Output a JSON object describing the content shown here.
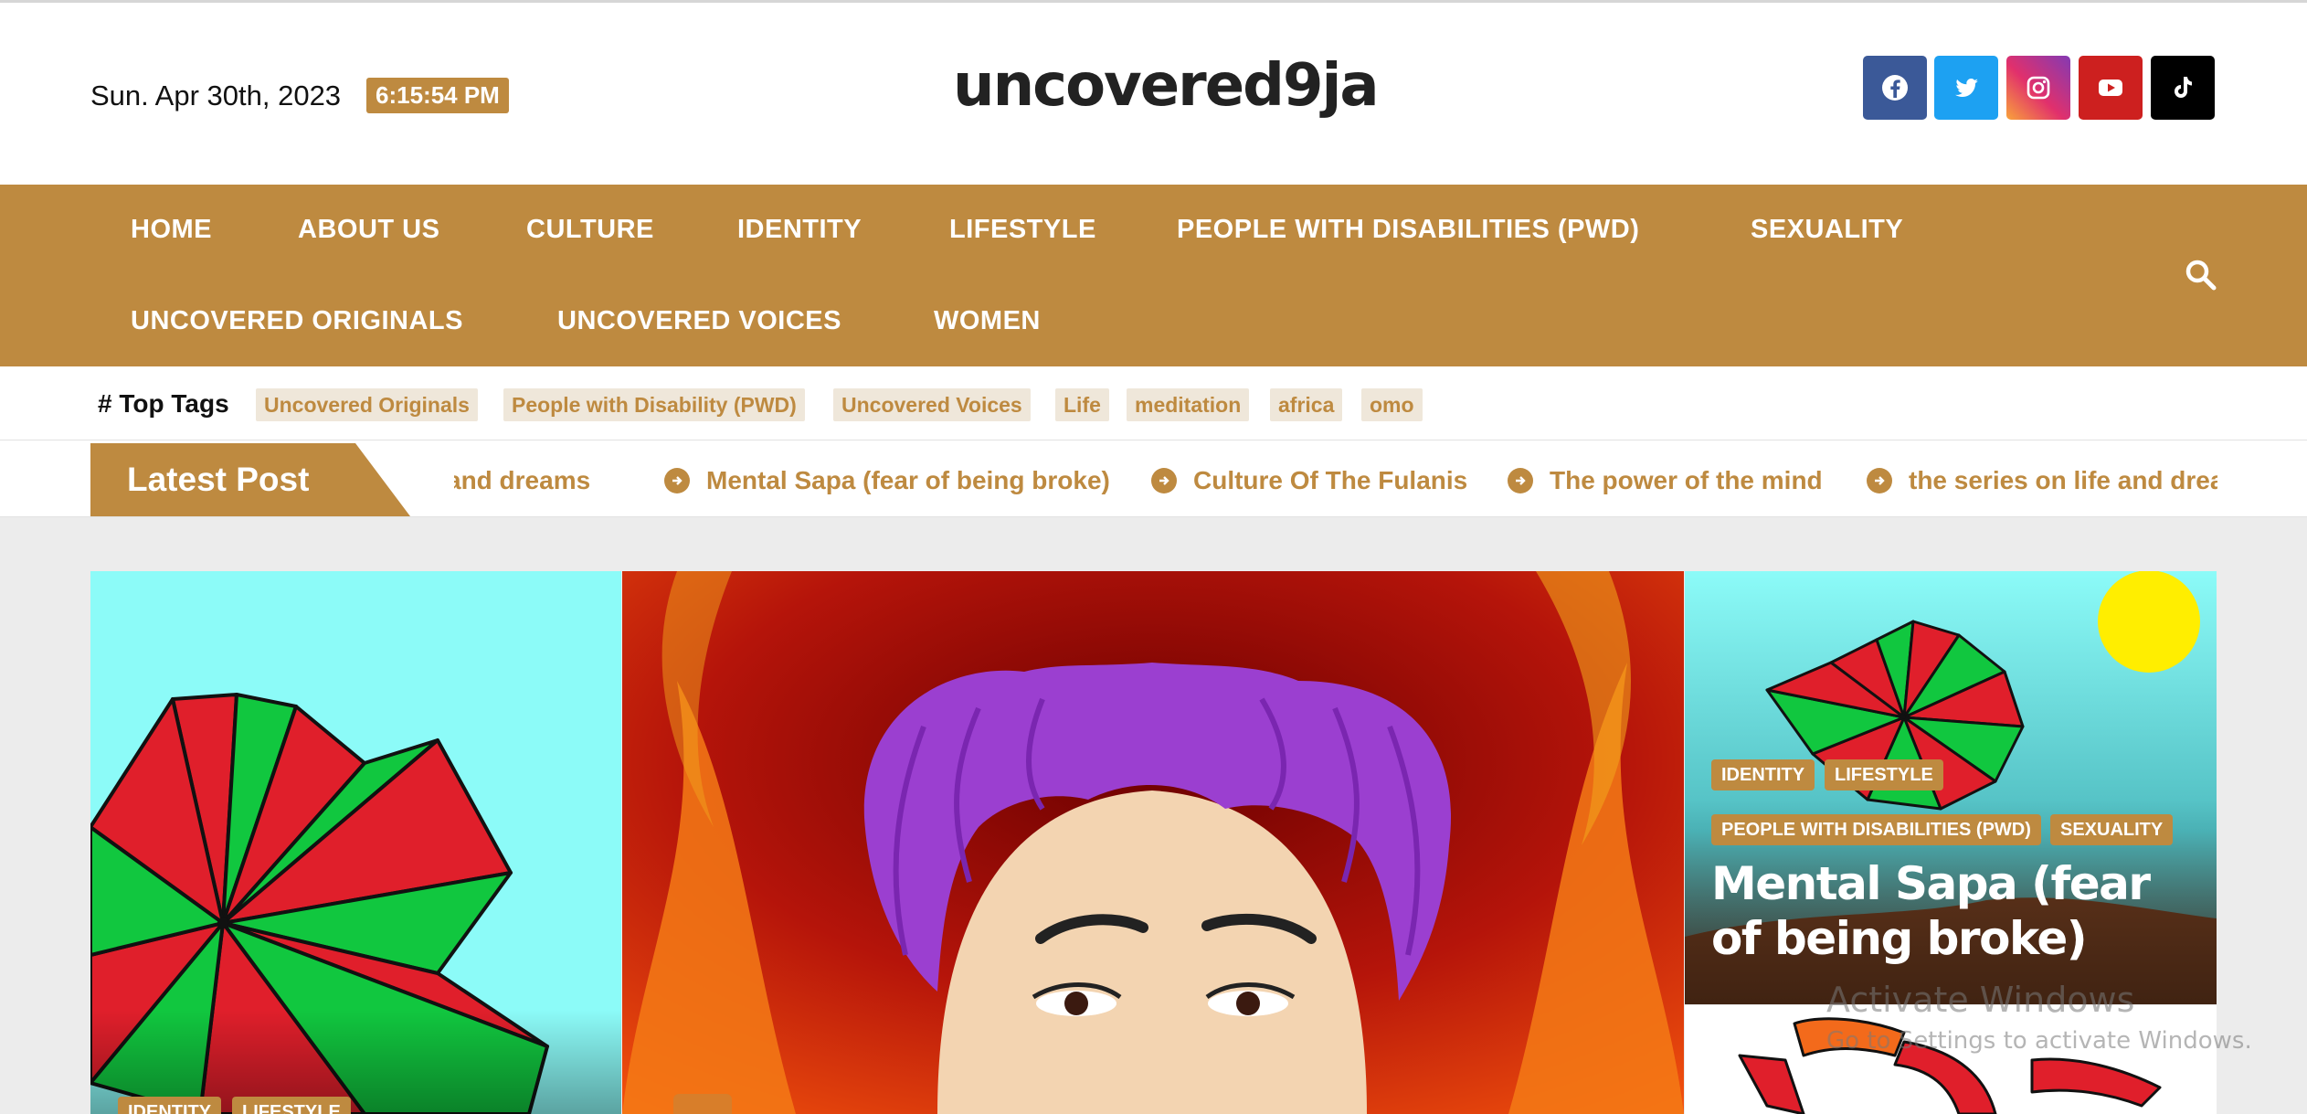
{
  "header": {
    "date": "Sun. Apr 30th, 2023",
    "time": "6:15:54 PM",
    "logo": "uncovered9ja",
    "social": [
      {
        "name": "facebook-icon",
        "color": "#3b5998"
      },
      {
        "name": "twitter-icon",
        "color": "#1da1f2"
      },
      {
        "name": "instagram-icon",
        "color": "#c13584"
      },
      {
        "name": "youtube-icon",
        "color": "#cd201f"
      },
      {
        "name": "tiktok-icon",
        "color": "#000000"
      }
    ]
  },
  "nav": {
    "items": [
      "HOME",
      "ABOUT US",
      "CULTURE",
      "IDENTITY",
      "LIFESTYLE",
      "PEOPLE WITH DISABILITIES (PWD)",
      "SEXUALITY",
      "UNCOVERED ORIGINALS",
      "UNCOVERED VOICES",
      "WOMEN"
    ]
  },
  "top_tags": {
    "label": "Top Tags",
    "tags": [
      "Uncovered Originals",
      "People with Disability (PWD)",
      "Uncovered Voices",
      "Life",
      "meditation",
      "africa",
      "omo"
    ]
  },
  "latest": {
    "label": "Latest Post",
    "items": [
      "and dreams",
      "Mental Sapa (fear of being broke)",
      "Culture Of The Fulanis",
      "The power of the mind",
      "the series on life and dreams"
    ]
  },
  "featured": {
    "left": {
      "categories": [
        "IDENTITY",
        "LIFESTYLE"
      ]
    },
    "right": {
      "categories": [
        "IDENTITY",
        "LIFESTYLE",
        "PEOPLE WITH DISABILITIES (PWD)",
        "SEXUALITY"
      ],
      "title": "Mental Sapa (fear of being broke)"
    }
  },
  "watermark": {
    "title": "Activate Windows",
    "subtitle": "Go to Settings to activate Windows."
  },
  "colors": {
    "accent": "#be8a40",
    "page_bg": "#ececec"
  }
}
